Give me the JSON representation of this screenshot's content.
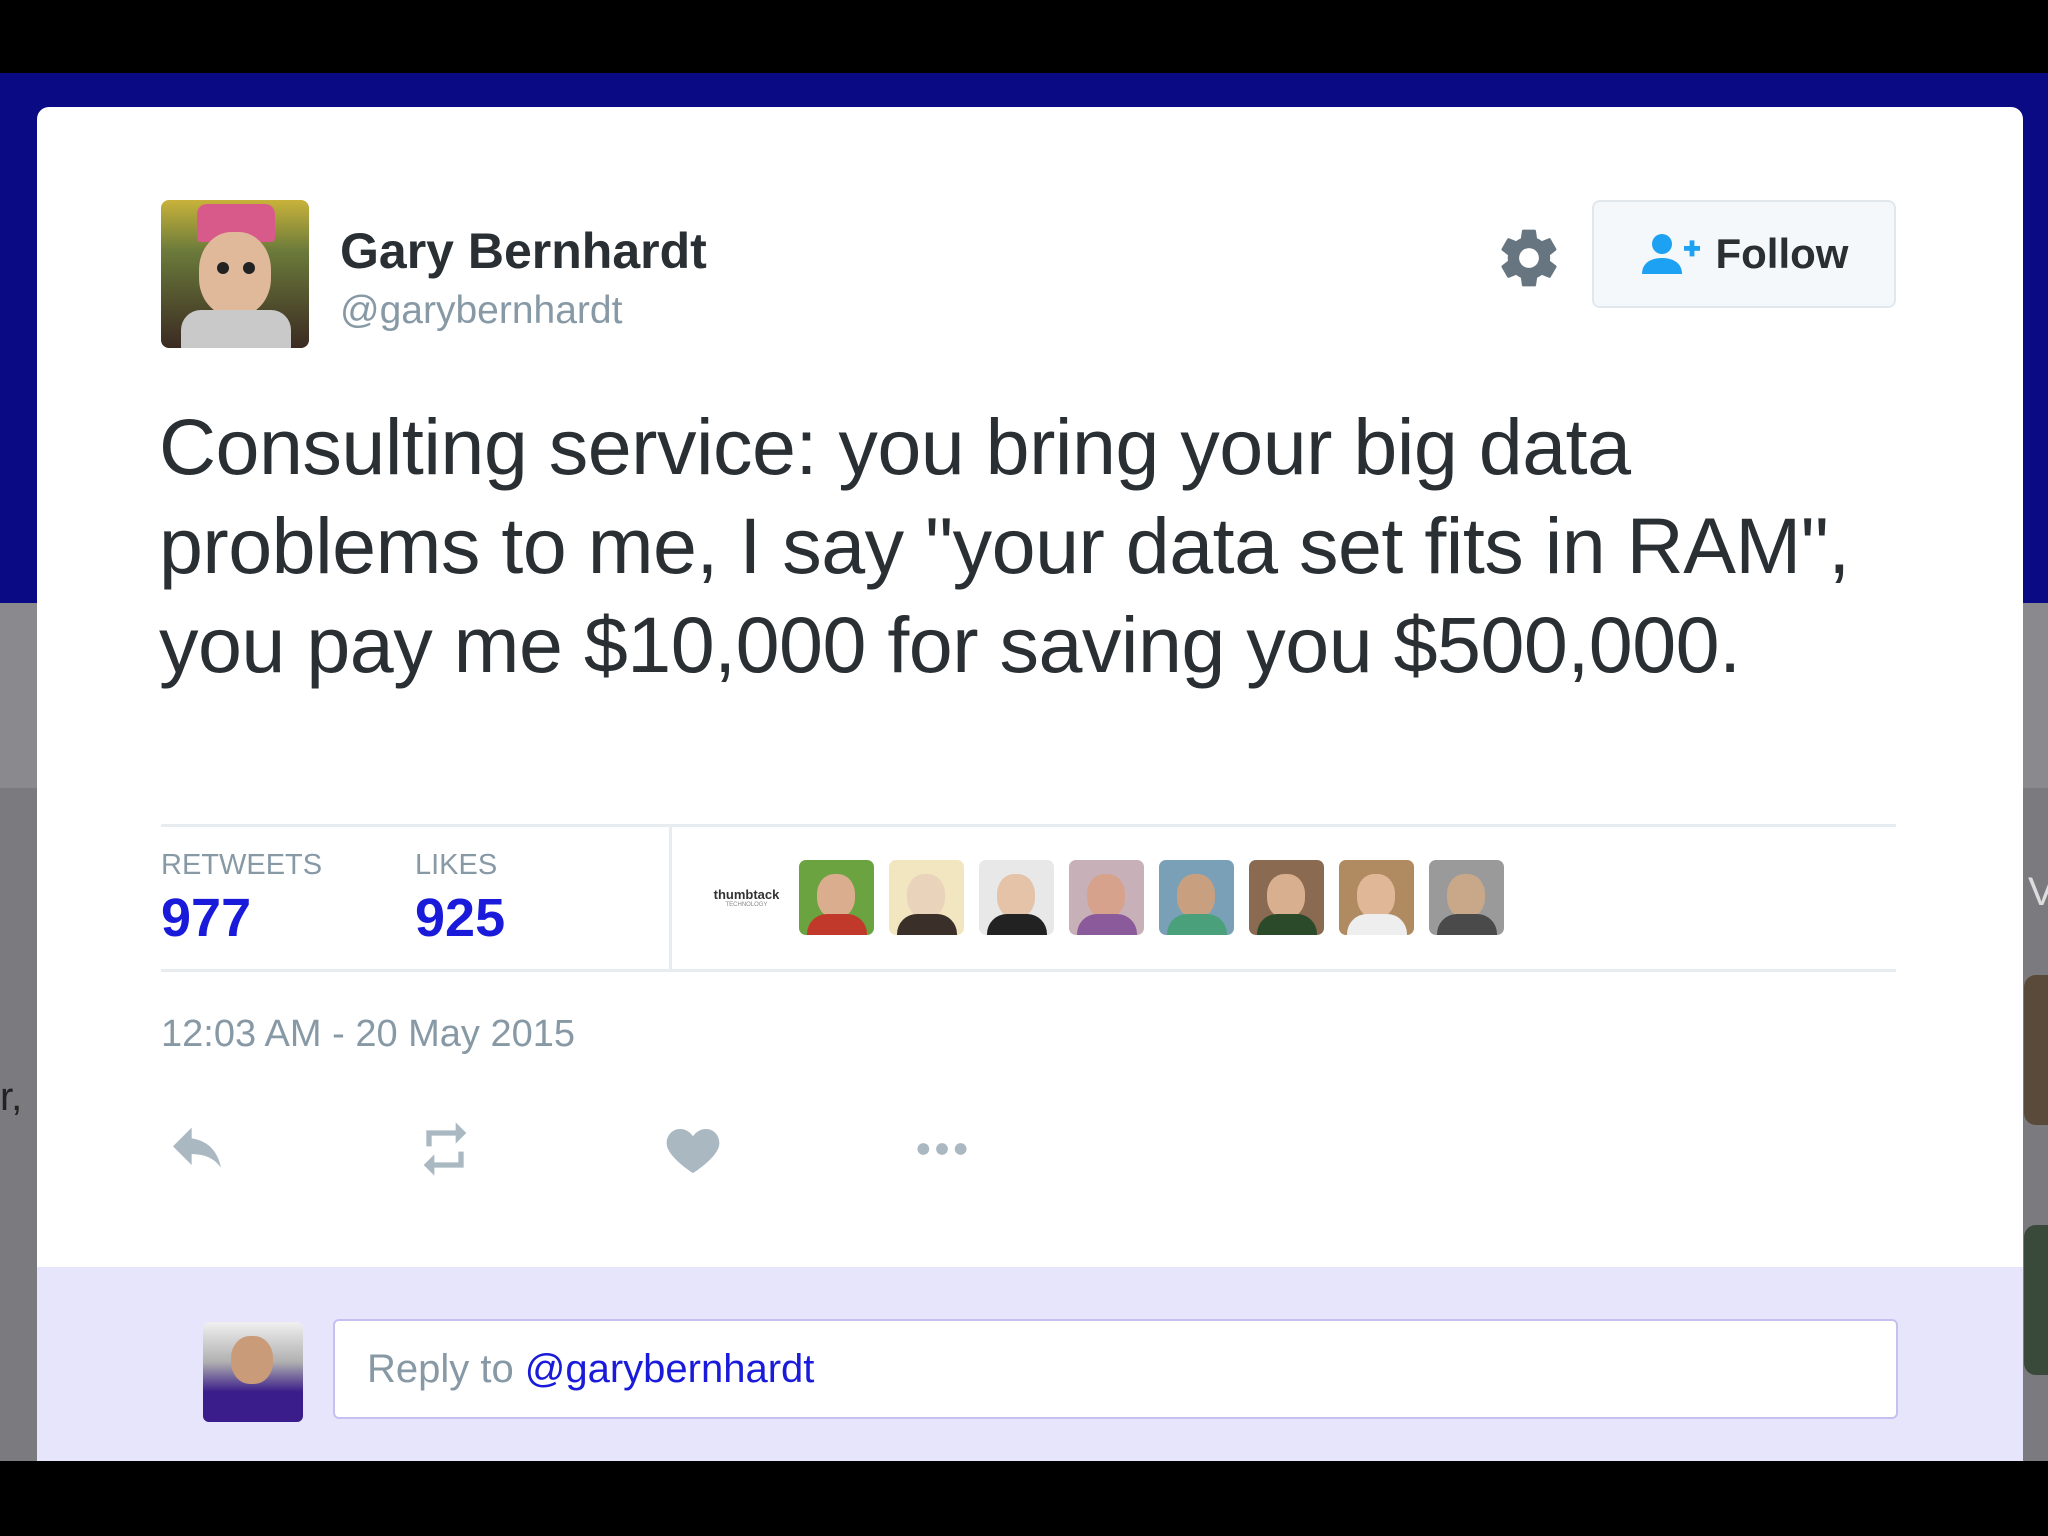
{
  "colors": {
    "accent": "#1a1adb",
    "text": "#292f33",
    "muted": "#8899a6",
    "reply_bg": "#e7e5fb",
    "header_blue": "#0a0a84"
  },
  "side_fragments": {
    "left": "r,",
    "right": "V"
  },
  "tweet": {
    "author_name": "Gary Bernhardt",
    "author_handle": "@garybernhardt",
    "follow_label": "Follow",
    "text": "Consulting service: you bring your big data problems to me, I say \"your data set fits in RAM\", you pay me $10,000 for saving you $500,000.",
    "stats": {
      "retweets_label": "RETWEETS",
      "retweets_value": "977",
      "likes_label": "LIKES",
      "likes_value": "925"
    },
    "likers": {
      "brand_name": "thumbtack",
      "brand_sub": "TECHNOLOGY",
      "avatar_count": 8
    },
    "timestamp": "12:03 AM - 20 May 2015",
    "actions": [
      "reply-icon",
      "retweet-icon",
      "like-icon",
      "more-icon"
    ]
  },
  "reply": {
    "prefix": "Reply to",
    "mention": "@garybernhardt"
  }
}
